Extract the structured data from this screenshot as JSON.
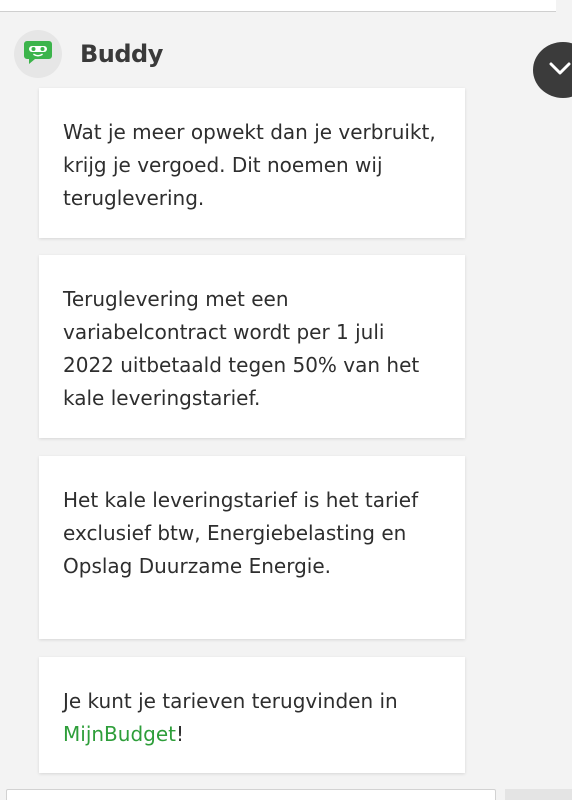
{
  "chat": {
    "bot_name": "Buddy",
    "messages": [
      {
        "text": "Wat je meer opwekt dan je verbruikt, krijg je vergoed. Dit noemen wij teruglevering."
      },
      {
        "text": "Teruglevering met een variabelcontract wordt per 1 juli 2022 uitbetaald tegen 50% van het kale leveringstarief."
      },
      {
        "text": "Het kale leveringstarief is het tarief exclusief btw, Energiebelasting en Opslag Duurzame Energie."
      },
      {
        "text_before_link": "Je kunt je tarieven terugvinden in ",
        "link_text": "MijnBudget",
        "text_after_link": "!"
      }
    ]
  },
  "icons": {
    "avatar": "buddy-robot-chat-icon",
    "collapse": "chevron-down-icon"
  },
  "colors": {
    "brand_green": "#3cb44b",
    "link_green": "#2e9e3a",
    "dark_button": "#3b3b3b",
    "background": "#f3f3f3",
    "bubble": "#ffffff"
  }
}
